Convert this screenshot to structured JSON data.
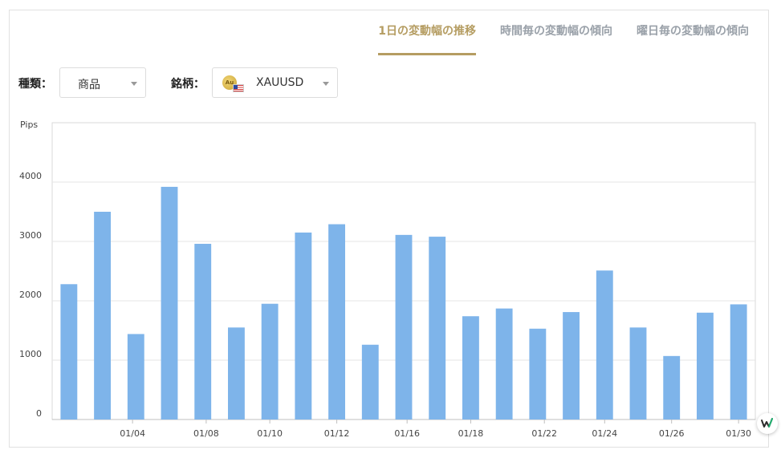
{
  "tabs": [
    {
      "label": "1日の変動幅の推移",
      "active": true
    },
    {
      "label": "時間毎の変動幅の傾向",
      "active": false
    },
    {
      "label": "曜日毎の変動幅の傾向",
      "active": false
    }
  ],
  "filters": {
    "type_label": "種類：",
    "type_value": "商品",
    "symbol_label": "銘柄：",
    "symbol_value": "XAUUSD",
    "coin_text": "Au"
  },
  "colors": {
    "bar": "#7eb4ea",
    "accent": "#b59d62",
    "tab_inactive": "#9aa1a9"
  },
  "chart_data": {
    "type": "bar",
    "ylabel": "Pips",
    "ylim": [
      0,
      5000
    ],
    "yticks": [
      0,
      1000,
      2000,
      3000,
      4000
    ],
    "grid": true,
    "x_tick_labels": [
      "01/04",
      "01/08",
      "01/10",
      "01/12",
      "01/16",
      "01/18",
      "01/22",
      "01/24",
      "01/26",
      "01/30"
    ],
    "x_tick_bar_index": [
      1.9,
      4.1,
      6.0,
      8.0,
      10.1,
      12.0,
      14.2,
      16.0,
      18.0,
      20.0
    ],
    "values": [
      2280,
      3500,
      1440,
      3920,
      2960,
      1550,
      1950,
      3150,
      3290,
      1260,
      3110,
      3080,
      1740,
      1870,
      1530,
      1810,
      2510,
      1550,
      1070,
      1800,
      1940
    ]
  }
}
